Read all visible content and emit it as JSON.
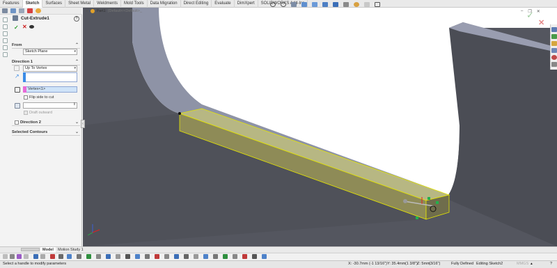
{
  "ribbon": {
    "tabs": [
      "Features",
      "Sketch",
      "Surfaces",
      "Sheet Metal",
      "Weldments",
      "Mold Tools",
      "Data Migration",
      "Direct Editing",
      "Evaluate",
      "DimXpert",
      "SOLIDWORKS Add-Ins"
    ],
    "active_tab": "Sketch"
  },
  "tree": {
    "part_name": "Part1",
    "config": "(Default<<Default>_"
  },
  "property_manager": {
    "title": "Cut-Extrude1",
    "from": {
      "label": "From",
      "value": "Sketch Plane"
    },
    "direction1": {
      "label": "Direction 1",
      "end_condition": "Up To Vertex",
      "vertex": "Vertex<1>",
      "flip_label": "Flip side to cut",
      "draft_label": "Draft outward"
    },
    "direction2": {
      "label": "Direction 2"
    },
    "selected_contours": {
      "label": "Selected Contours"
    }
  },
  "bottom_tabs": [
    "Model",
    "Motion Study 1"
  ],
  "status": {
    "message": "Select a handle to modify parameters",
    "coord_x": "X: -30.7mm",
    "coord_x_frac": "(-1 13/16\")",
    "coord_y": "Y: 35.4mm",
    "coord_y_frac": "(1 3/8\")",
    "coord_z": "Z: 5mm",
    "coord_z_frac": "(3/16\")",
    "state": "Fully Defined",
    "editing": "Editing Sketch2",
    "units": "MMGS"
  },
  "colors": {
    "background": "#ffffff",
    "model_face": "#54565f",
    "model_top": "#8d93a8",
    "preview_fill": "#d9d98a",
    "preview_edge": "#e6e600",
    "accent_blue": "#3c8ce6",
    "selection_pink": "#e86ad7"
  }
}
